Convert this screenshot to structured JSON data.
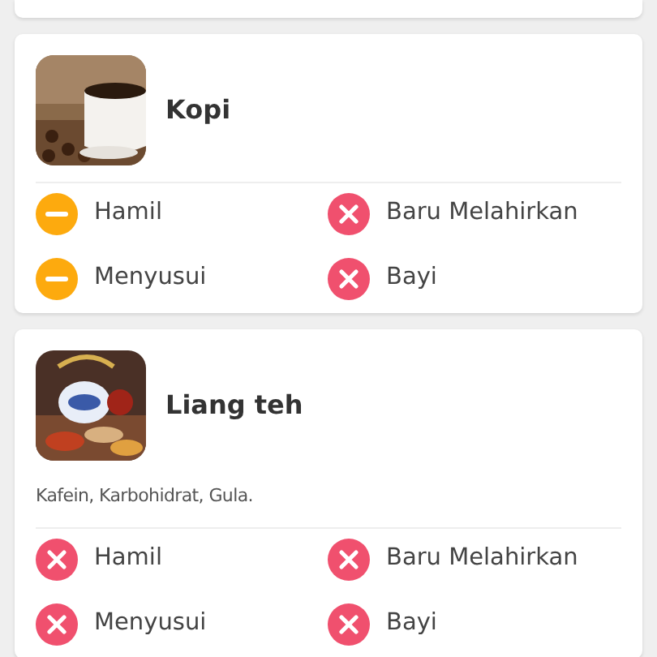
{
  "items": [
    {
      "name": "Kopi",
      "conditions": [
        {
          "label": "Hamil",
          "kind": "caution"
        },
        {
          "label": "Baru Melahirkan",
          "kind": "avoid"
        },
        {
          "label": "Menyusui",
          "kind": "caution"
        },
        {
          "label": "Bayi",
          "kind": "avoid"
        }
      ]
    },
    {
      "name": "Liang teh",
      "description": "Kafein, Karbohidrat, Gula.",
      "conditions": [
        {
          "label": "Hamil",
          "kind": "avoid"
        },
        {
          "label": "Baru Melahirkan",
          "kind": "avoid"
        },
        {
          "label": "Menyusui",
          "kind": "avoid"
        },
        {
          "label": "Bayi",
          "kind": "avoid"
        }
      ]
    }
  ]
}
